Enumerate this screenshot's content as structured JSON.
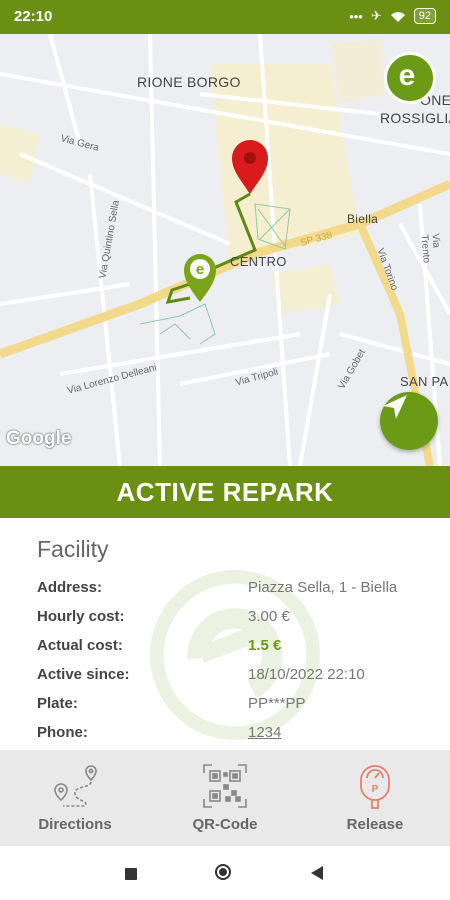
{
  "status": {
    "time": "22:10",
    "battery": "92",
    "dots": "•••"
  },
  "map": {
    "labels": {
      "borgo": "RIONE BORGO",
      "rossiglia": "ROSSIGLIA",
      "centro": "CENTRO",
      "biella": "Biella",
      "sanpa": "SAN PA",
      "frag": "ONE"
    },
    "streets": {
      "gera": "Via Gera",
      "quintino": "Via Quintino Sella",
      "delleani": "Via Lorenzo Delleani",
      "tripoli": "Via Tripoli",
      "torino": "Via Torino",
      "trento": "Via Trento",
      "gobet": "Via Gobet",
      "sf": "SP 338",
      "mini": "Via"
    },
    "google": "Google",
    "logo_letter": "e"
  },
  "header": {
    "title": "ACTIVE REPARK"
  },
  "details": {
    "facility": "Facility",
    "rows": [
      {
        "label": "Address:",
        "value": "Piazza Sella, 1 - Biella"
      },
      {
        "label": "Hourly cost:",
        "value": "3.00 €"
      },
      {
        "label": "Actual cost:",
        "value": "1.5 €"
      },
      {
        "label": "Active since:",
        "value": "18/10/2022 22:10"
      },
      {
        "label": "Plate:",
        "value": "PP***PP"
      },
      {
        "label": "Phone:",
        "value": "1234"
      }
    ]
  },
  "actions": {
    "directions": "Directions",
    "qr": "QR-Code",
    "release": "Release"
  },
  "colors": {
    "brand": "#6b8f12",
    "accent": "#6b9a16",
    "pin": "#d81b1b",
    "release": "#e5806a"
  }
}
